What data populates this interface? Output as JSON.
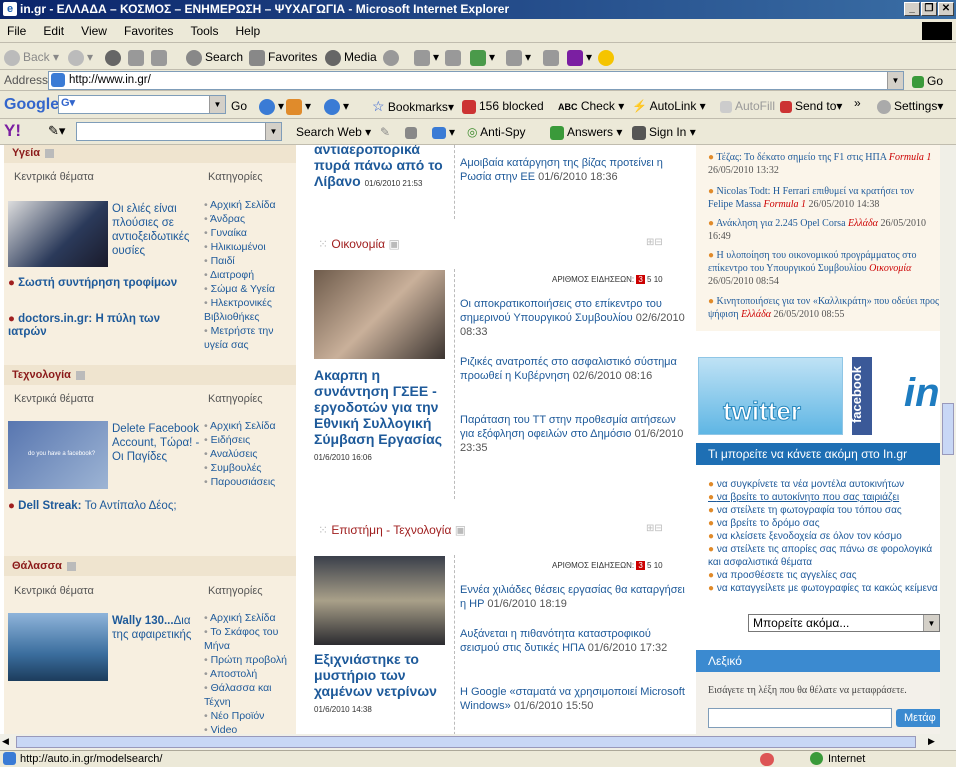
{
  "window": {
    "title": "in.gr - ΕΛΛΑΔΑ – ΚΟΣΜΟΣ – ΕΝΗΜΕΡΩΣΗ – ΨΥΧΑΓΩΓΙΑ - Microsoft Internet Explorer"
  },
  "menu": [
    "File",
    "Edit",
    "View",
    "Favorites",
    "Tools",
    "Help"
  ],
  "toolbar": {
    "back": "Back",
    "search": "Search",
    "favorites": "Favorites",
    "media": "Media"
  },
  "address": {
    "label": "Address",
    "url": "http://www.in.gr/",
    "go": "Go"
  },
  "google": {
    "go": "Go",
    "bookmarks": "Bookmarks",
    "blocked": "156 blocked",
    "check": "Check",
    "autolink": "AutoLink",
    "autofill": "AutoFill",
    "sendto": "Send to",
    "settings": "Settings"
  },
  "yahoo": {
    "search_web": "Search Web",
    "antispy": "Anti-Spy",
    "answers": "Answers",
    "signin": "Sign In"
  },
  "left": {
    "health": {
      "title": "Υγεία",
      "main_label": "Κεντρικά θέματα",
      "cat_label": "Κατηγορίες",
      "feature": "Οι ελιές είναι πλούσιες σε αντιοξειδωτικές ουσίες",
      "links": [
        "Σωστή συντήρηση τροφίμων",
        "doctors.in.gr: Η πύλη των ιατρών"
      ],
      "cats": [
        "Αρχική Σελίδα",
        "Άνδρας",
        "Γυναίκα",
        "Ηλικιωμένοι",
        "Παιδί",
        "Διατροφή",
        "Σώμα & Υγεία",
        "Ηλεκτρονικές Βιβλιοθήκες",
        "Μετρήστε την υγεία σας"
      ]
    },
    "tech": {
      "title": "Τεχνολογία",
      "main_label": "Κεντρικά θέματα",
      "cat_label": "Κατηγορίες",
      "thumb_text": "do you have a facebook?",
      "feature": "Delete Facebook Account, Τώρα! - Οι Παγίδες",
      "link_bold": "Dell Streak:",
      "link_rest": "Το Αντίπαλο Δέος;",
      "cats": [
        "Αρχική Σελίδα",
        "Ειδήσεις",
        "Αναλύσεις",
        "Συμβουλές",
        "Παρουσιάσεις"
      ]
    },
    "sea": {
      "title": "Θάλασσα",
      "main_label": "Κεντρικά θέματα",
      "cat_label": "Κατηγορίες",
      "feature_bold": "Wally 130...",
      "feature_rest": "Δια της αφαιρετικής",
      "cats": [
        "Αρχική Σελίδα",
        "Το Σκάφος του Μήνα",
        "Πρώτη προβολή",
        "Αποστολή",
        "Θάλασσα και Τέχνη",
        "Νέο Προϊόν",
        "Video"
      ]
    }
  },
  "middle": {
    "top_headline": "αντιαεροπορικά πυρά πάνω από το Λίβανο",
    "top_date": "01/6/2010 21:53",
    "top_right": "Αμοιβαία κατάργηση της βίζας προτείνει η Ρωσία στην ΕΕ",
    "top_right_date": "01/6/2010 18:36",
    "economy": {
      "title": "Οικονομία",
      "count_label": "ΑΡΙΘΜΟΣ ΕΙΔΗΣΕΩΝ:",
      "count": "3",
      "of": "5 10",
      "headline": "Ακαρπη η συνάντηση ΓΣΕΕ - εργοδοτών για την Εθνική Συλλογική Σύμβαση Εργασίας",
      "headline_date": "01/6/2010 16:06",
      "items": [
        {
          "t": "Οι αποκρατικοποιήσεις στο επίκεντρο του σημερινού Υπουργικού Συμβουλίου",
          "d": "02/6/2010 08:33"
        },
        {
          "t": "Ριζικές ανατροπές στο ασφαλιστικό σύστημα προωθεί η Κυβέρνηση",
          "d": "02/6/2010 08:16"
        },
        {
          "t": "Παράταση του ΤΤ στην προθεσμία αιτήσεων για εξόφληση οφειλών στο Δημόσιο",
          "d": "01/6/2010 23:35"
        }
      ]
    },
    "science": {
      "title": "Επιστήμη - Τεχνολογία",
      "count_label": "ΑΡΙΘΜΟΣ ΕΙΔΗΣΕΩΝ:",
      "count": "3",
      "of": "5 10",
      "headline": "Εξιχνιάστηκε το μυστήριο των χαμένων νετρίνων",
      "headline_date": "01/6/2010 14:38",
      "items": [
        {
          "t": "Εννέα χιλιάδες θέσεις εργασίας θα καταργήσει η HP",
          "d": "01/6/2010 18:19"
        },
        {
          "t": "Αυξάνεται η πιθανότητα καταστροφικού σεισμού στις δυτικές ΗΠΑ",
          "d": "01/6/2010 17:32"
        },
        {
          "t": "Η Google «σταματά να χρησιμοποιεί Microsoft Windows»",
          "d": "01/6/2010 15:50"
        }
      ]
    }
  },
  "right": {
    "news": [
      {
        "t": "Τέζας: Το δέκατο σημείο της F1 στις ΗΠΑ",
        "c": "Formula 1",
        "d": "26/05/2010 13:32"
      },
      {
        "t": "Nicolas Todt: Η Ferrari επιθυμεί να κρατήσει τον Felipe Massa",
        "c": "Formula 1",
        "d": "26/05/2010 14:38"
      },
      {
        "t": "Ανάκληση για 2.245 Opel Corsa",
        "c": "Ελλάδα",
        "d": "26/05/2010 16:49"
      },
      {
        "t": "Η υλοποίηση του οικονομικού προγράμματος στο επίκεντρο του Υπουργικού Συμβουλίου",
        "c": "Οικονομία",
        "d": "26/05/2010 08:54"
      },
      {
        "t": "Κινητοποιήσεις για τον «Καλλικράτη» που οδεύει προς ψήφιση",
        "c": "Ελλάδα",
        "d": "26/05/2010 08:55"
      }
    ],
    "twitter": "twitter",
    "facebook": "facebook",
    "more_title": "Τι μπορείτε να κάνετε ακόμη στο In.gr",
    "more_links": [
      "να συγκρίνετε τα νέα μοντέλα αυτοκινήτων",
      "να βρείτε το αυτοκίνητο που σας ταιριάζει",
      "να στείλετε τη φωτογραφία του τόπου σας",
      "να βρείτε το δρόμο σας",
      "να κλείσετε ξενοδοχεία σε όλον τον κόσμο",
      "να στείλετε τις απορίες σας πάνω σε φορολογικά και ασφαλιστικά θέματα",
      "να προσθέσετε τις αγγελίες σας",
      "να καταγγείλετε με φωτογραφίες τα κακώς κείμενα"
    ],
    "select_value": "Μπορείτε ακόμα...",
    "dict_title": "Λεξικό",
    "dict_prompt": "Εισάγετε τη λέξη που θα θέλατε να μεταφράσετε.",
    "dict_button": "Μετάφ"
  },
  "status": {
    "url": "http://auto.in.gr/modelsearch/",
    "zone": "Internet"
  }
}
